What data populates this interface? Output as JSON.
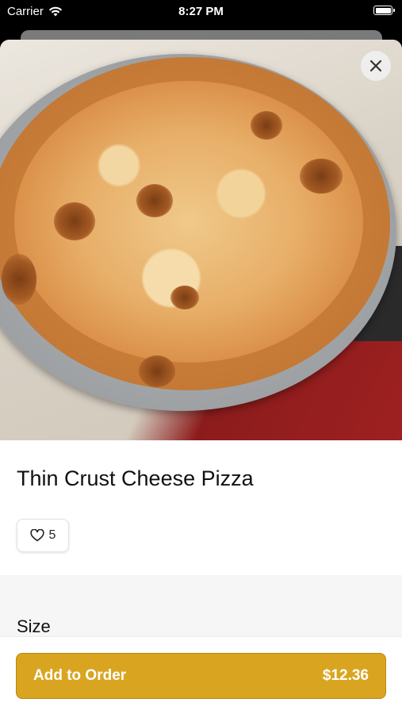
{
  "status_bar": {
    "carrier": "Carrier",
    "time": "8:27 PM",
    "icons": [
      "wifi-icon",
      "battery-icon"
    ]
  },
  "item": {
    "image": "pizza-photo",
    "title": "Thin Crust Cheese Pizza",
    "likes": "5"
  },
  "options": {
    "size_heading": "Size"
  },
  "footer": {
    "add_label": "Add to Order",
    "price": "$12.36"
  },
  "colors": {
    "accent": "#d9a521"
  }
}
